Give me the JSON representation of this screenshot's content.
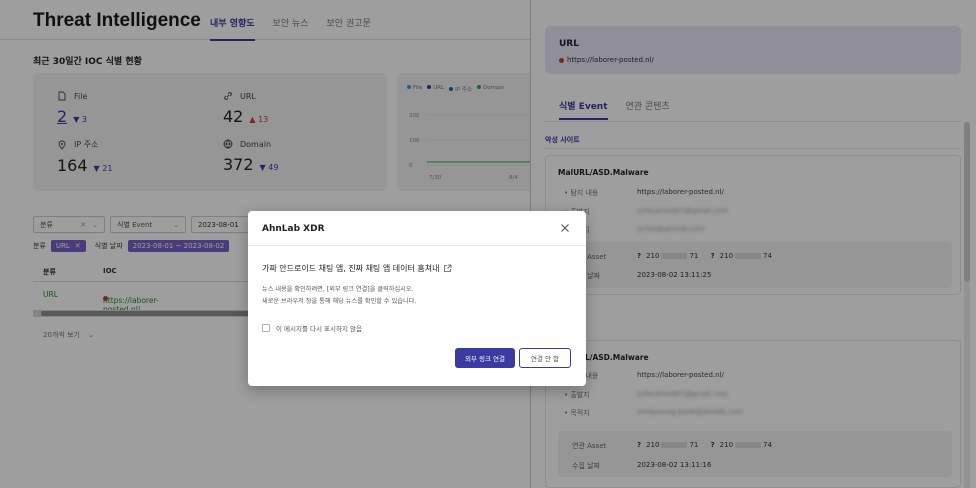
{
  "header": {
    "app_title": "Threat Intelligence",
    "tabs": [
      {
        "label": "내부 영향도",
        "active": true
      },
      {
        "label": "보안 뉴스",
        "active": false
      },
      {
        "label": "보안 권고문",
        "active": false
      }
    ]
  },
  "summary": {
    "title": "최근 30일간 IOC 식별 현황",
    "stats": [
      {
        "label": "File",
        "value": "2",
        "delta": "3",
        "direction": "down",
        "icon": "file-icon"
      },
      {
        "label": "URL",
        "value": "42",
        "delta": "13",
        "direction": "up",
        "icon": "link-icon"
      },
      {
        "label": "IP 주소",
        "value": "164",
        "delta": "21",
        "direction": "down",
        "icon": "location-icon"
      },
      {
        "label": "Domain",
        "value": "372",
        "delta": "49",
        "direction": "down",
        "icon": "globe-icon"
      }
    ]
  },
  "chart_data": {
    "type": "line",
    "legend": [
      "File",
      "URL",
      "IP 주소",
      "Domain"
    ],
    "colors": [
      "#5b8fd9",
      "#3a3aa0",
      "#1f5fbf",
      "#2ea84a"
    ],
    "y_ticks": [
      "200",
      "100",
      "0"
    ],
    "x_ticks": [
      "7/30",
      "8/4"
    ],
    "ylim": [
      0,
      200
    ]
  },
  "filters": {
    "category_label": "분류",
    "event_label": "식별 Event",
    "date_value": "2023-08-01"
  },
  "chips": {
    "category_label": "분류",
    "category_chip": "URL",
    "date_label": "식별 날짜",
    "date_chip": "2023-08-01 ~ 2023-08-02"
  },
  "table": {
    "columns": [
      "분류",
      "IOC"
    ],
    "rows": [
      {
        "category": "URL",
        "ioc": "https://laborer-posted.nl/"
      }
    ],
    "page_size": "20개씩 보기"
  },
  "drawer": {
    "card_title": "URL",
    "card_value": "https://laborer-posted.nl/",
    "tabs": [
      {
        "label": "식별 Event",
        "active": true
      },
      {
        "label": "연관 콘텐츠",
        "active": false
      }
    ],
    "category_title": "악성 사이트",
    "events": [
      {
        "name": "MalURL/ASD.Malware",
        "detect_label": "탐지 내용",
        "detect_value": "https://laborer-posted.nl/",
        "sender_label": "출발지",
        "sender_value": "schicarlord07@gmail.com",
        "dest_label": "목적지",
        "dest_value": "jschoi@ahnlab.com",
        "asset_label": "연관 Asset",
        "asset_1a": "210",
        "asset_1b": "71",
        "asset_2a": "210",
        "asset_2b": "74",
        "time_label": "수집 날짜",
        "time_value": "2023-08-02 13:11:25"
      },
      {
        "name": "MalURL/ASD.Malware",
        "detect_label": "탐지 내용",
        "detect_value": "https://laborer-posted.nl/",
        "sender_label": "출발지",
        "sender_value": "schicarlord07@gmail.com",
        "dest_label": "목적지",
        "dest_value": "minkyoung.baek@ahnlab.com",
        "asset_label": "연관 Asset",
        "asset_1a": "210",
        "asset_1b": "71",
        "asset_2a": "210",
        "asset_2b": "74",
        "time_label": "수집 날짜",
        "time_value": "2023-08-02 13:11:16"
      }
    ]
  },
  "modal": {
    "title": "AhnLab XDR",
    "headline": "가짜 안드로이드 채팅 앱, 진짜 채팅 앱 데이터 훔쳐내",
    "line1": "뉴스 내용을 확인하려면, [외부 링크 연결]을 클릭하십시오.",
    "line2": "새로운 브라우저 창을 통해 해당 뉴스를 확인할 수 있습니다.",
    "checkbox_label": "이 메시지를 다시 표시하지 않음",
    "primary_button": "외부 링크 연결",
    "secondary_button": "연결 안 함"
  }
}
